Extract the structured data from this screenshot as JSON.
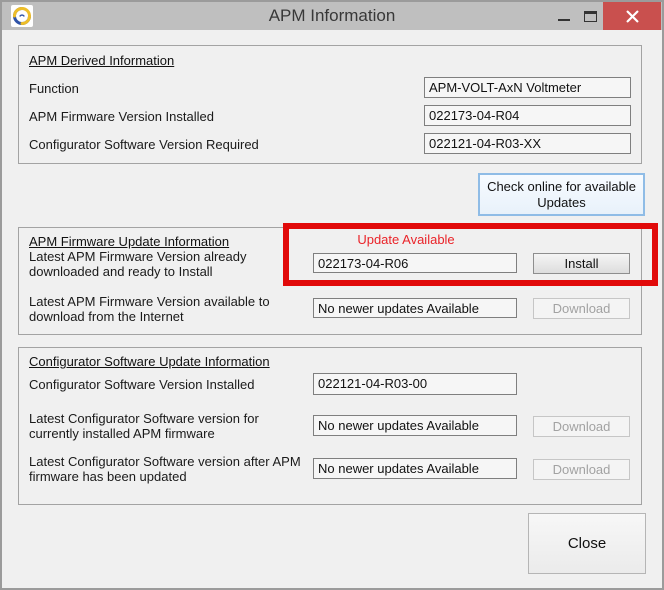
{
  "titlebar": {
    "title": "APM Information",
    "icons": {
      "app_logo": "swirl-logo",
      "minimize": "dash",
      "maximize": "square",
      "close": "x"
    }
  },
  "derived": {
    "heading": "APM Derived Information",
    "rows": [
      {
        "label": "Function",
        "value": "APM-VOLT-AxN Voltmeter"
      },
      {
        "label": "APM Firmware Version Installed",
        "value": "022173-04-R04"
      },
      {
        "label": "Configurator Software Version Required",
        "value": "022121-04-R03-XX"
      }
    ]
  },
  "check_button": {
    "line1": "Check online for available",
    "line2": "Updates"
  },
  "firmware_update": {
    "heading": "APM Firmware Update Information",
    "status": "Update Available",
    "rows": [
      {
        "label1": "Latest APM Firmware Version already",
        "label2": "downloaded and ready to Install",
        "value": "022173-04-R06",
        "button": "Install",
        "enabled": true
      },
      {
        "label1": "Latest APM Firmware Version available to",
        "label2": "download from the Internet",
        "value": "No newer updates Available",
        "button": "Download",
        "enabled": false
      }
    ]
  },
  "software_update": {
    "heading": "Configurator Software Update Information",
    "rows": [
      {
        "label1": "Configurator Software Version Installed",
        "label2": "",
        "value": "022121-04-R03-00"
      },
      {
        "label1": "Latest Configurator Software version for",
        "label2": "currently installed APM firmware",
        "value": "No newer updates Available",
        "button": "Download",
        "enabled": false
      },
      {
        "label1": "Latest Configurator Software version after APM",
        "label2": "firmware has been updated",
        "value": "No newer updates Available",
        "button": "Download",
        "enabled": false
      }
    ]
  },
  "close_button": "Close",
  "colors": {
    "annotation_red": "#e10a0a",
    "status_red": "#ea2329",
    "titlebar_close_red": "#c9504e",
    "check_button_blue": "#8fbce6",
    "titlebar_gray": "#bfbfbf",
    "dialog_gray": "#f0f0f0"
  }
}
